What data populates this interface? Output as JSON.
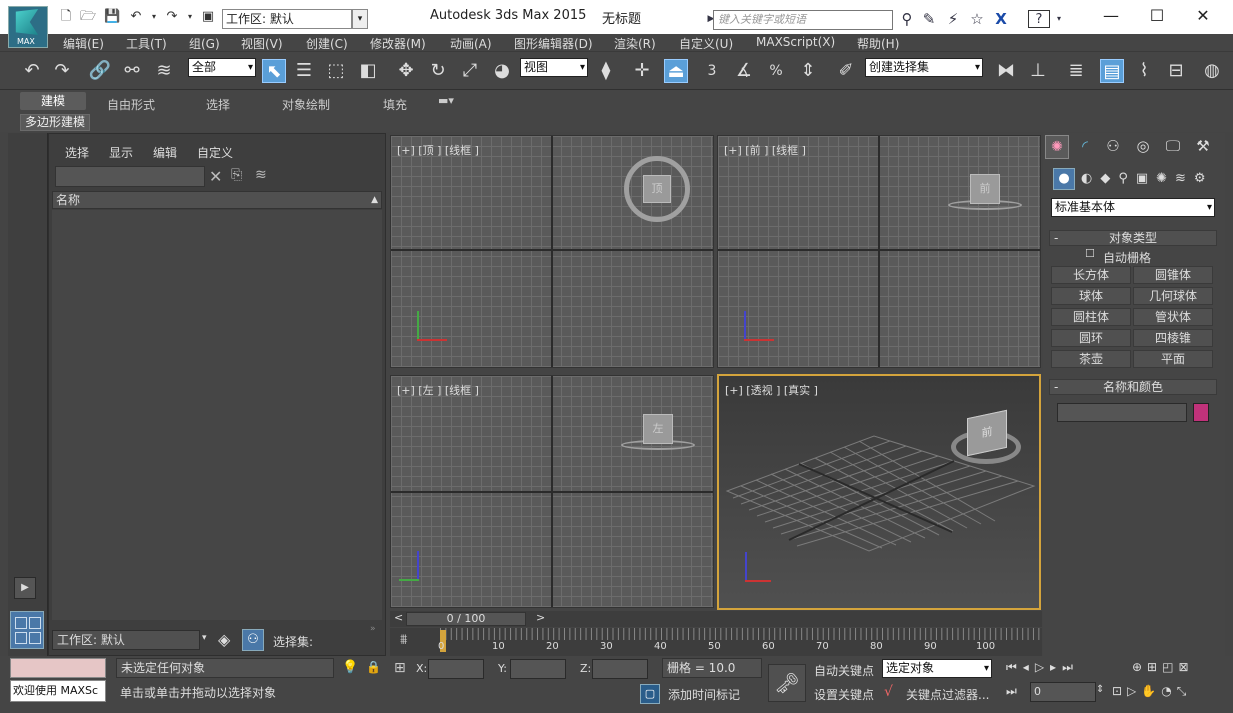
{
  "titlebar": {
    "logo": "MAX",
    "workspace": "工作区: 默认",
    "app_title": "Autodesk 3ds Max  2015",
    "doc_title": "无标题",
    "search_placeholder": "键入关键字或短语",
    "help": "?"
  },
  "menu": [
    "编辑(E)",
    "工具(T)",
    "组(G)",
    "视图(V)",
    "创建(C)",
    "修改器(M)",
    "动画(A)",
    "图形编辑器(D)",
    "渲染(R)",
    "自定义(U)",
    "MAXScript(X)",
    "帮助(H)"
  ],
  "toolbar": {
    "filter": "全部",
    "refcoord": "视图",
    "selset": "创建选择集",
    "snap3": "3",
    "snap_pct": "%"
  },
  "ribbon": {
    "tabs": [
      "建模",
      "自由形式",
      "选择",
      "对象绘制",
      "填充"
    ],
    "sub": "多边形建模"
  },
  "explorer": {
    "menus": [
      "选择",
      "显示",
      "编辑",
      "自定义"
    ],
    "col": "名称",
    "workspace": "工作区: 默认",
    "selset": "选择集:"
  },
  "viewports": {
    "top": "[+] [顶 ] [线框 ]",
    "front": "[+] [前 ] [线框 ]",
    "left": "[+] [左 ] [线框 ]",
    "persp": "[+] [透视 ] [真实 ]",
    "cube_top": "顶",
    "cube_front": "前",
    "cube_left": "左",
    "cube_persp": "前"
  },
  "timeline": {
    "pos": "0 / 100",
    "ticks": [
      "0",
      "10",
      "20",
      "30",
      "40",
      "50",
      "60",
      "70",
      "80",
      "90",
      "100"
    ]
  },
  "status": {
    "welcome": "欢迎使用 MAXSc",
    "no_sel": "未选定任何对象",
    "hint": "单击或单击并拖动以选择对象",
    "x": "X:",
    "y": "Y:",
    "z": "Z:",
    "grid": "栅格 = 10.0",
    "add_tag": "添加时间标记",
    "autokey": "自动关键点",
    "setkey": "设置关键点",
    "selobj": "选定对象",
    "keyfilter": "关键点过滤器...",
    "frame": "0"
  },
  "cmd": {
    "dropdown": "标准基本体",
    "objtype": "对象类型",
    "autogrid": "自动栅格",
    "buttons": [
      "长方体",
      "圆锥体",
      "球体",
      "几何球体",
      "圆柱体",
      "管状体",
      "圆环",
      "四棱锥",
      "茶壶",
      "平面"
    ],
    "namecolor": "名称和颜色",
    "swatch": "#c0327a"
  }
}
